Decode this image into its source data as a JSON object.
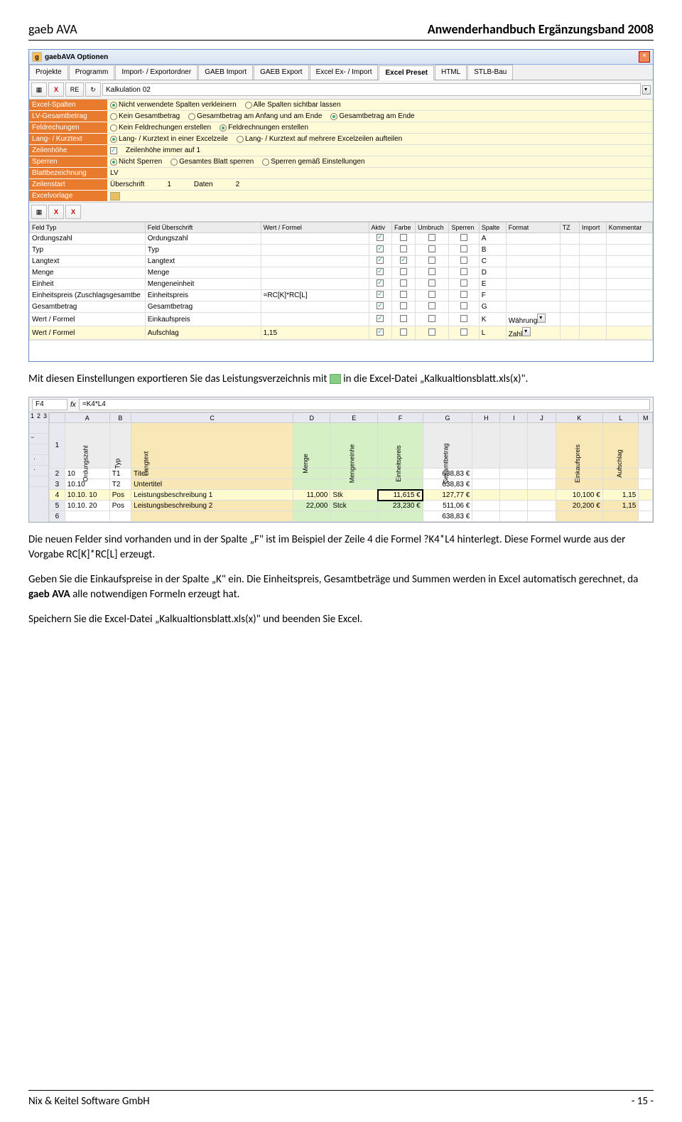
{
  "header": {
    "left": "gaeb AVA",
    "right": "Anwenderhandbuch Ergänzungsband 2008"
  },
  "win1": {
    "title": "gaebAVA Optionen",
    "tabs": [
      "Projekte",
      "Programm",
      "Import- / Exportordner",
      "GAEB Import",
      "GAEB Export",
      "Excel Ex- / Import",
      "Excel Preset",
      "HTML",
      "STLB-Bau"
    ],
    "active_tab": "Excel Preset",
    "tool_labels": {
      "re": "RE"
    },
    "kalk_input": "Kalkulation 02",
    "setting_labels": [
      "Excel-Spalten",
      "LV-Gesamtbetrag",
      "Feldrechungen",
      "Lang- / Kurztext",
      "Zeilenhöhe",
      "Sperren",
      "Blattbezeichnung",
      "Zeilenstart",
      "Excelvorlage"
    ],
    "settings": {
      "spalten": [
        "Nicht verwendete Spalten verkleinern",
        "Alle Spalten sichtbar lassen"
      ],
      "spalten_sel": 0,
      "gesamtbetrag": [
        "Kein Gesamtbetrag",
        "Gesamtbetrag am Anfang und am Ende",
        "Gesamtbetrag am Ende"
      ],
      "gesamtbetrag_sel": 2,
      "feldrech": [
        "Kein Feldrechungen erstellen",
        "Feldrechnungen erstellen"
      ],
      "feldrech_sel": 1,
      "langkurz": [
        "Lang- / Kurztext in einer Excelzeile",
        "Lang- / Kurztext auf mehrere Excelzeilen aufteilen"
      ],
      "langkurz_sel": 0,
      "zeilenhoehe": "Zeilenhöhe immer auf 1",
      "sperren": [
        "Nicht Sperren",
        "Gesamtes Blatt sperren",
        "Sperren gemäß Einstellungen"
      ],
      "sperren_sel": 0,
      "blatt": "LV",
      "zeilenstart_ub": "Überschrift",
      "zeilenstart_ub_v": "1",
      "zeilenstart_d": "Daten",
      "zeilenstart_d_v": "2"
    },
    "field_headers": [
      "Feld Typ",
      "Feld Überschrift",
      "Wert / Formel",
      "Aktiv",
      "Farbe",
      "Umbruch",
      "Sperren",
      "Spalte",
      "Format",
      "TZ",
      "Import",
      "Kommentar"
    ],
    "field_rows": [
      {
        "typ": "Ordungszahl",
        "ub": "Ordungszahl",
        "wf": "",
        "aktiv": true,
        "farbe": false,
        "umb": false,
        "spr": false,
        "sp": "A",
        "fmt": "",
        "tz": "",
        "imp": "",
        "kom": ""
      },
      {
        "typ": "Typ",
        "ub": "Typ",
        "wf": "",
        "aktiv": true,
        "farbe": false,
        "umb": false,
        "spr": false,
        "sp": "B",
        "fmt": "",
        "tz": "",
        "imp": "",
        "kom": ""
      },
      {
        "typ": "Langtext",
        "ub": "Langtext",
        "wf": "",
        "aktiv": true,
        "farbe": true,
        "umb": false,
        "spr": false,
        "sp": "C",
        "fmt": "",
        "tz": "",
        "imp": "",
        "kom": ""
      },
      {
        "typ": "Menge",
        "ub": "Menge",
        "wf": "",
        "aktiv": true,
        "farbe": false,
        "umb": false,
        "spr": false,
        "sp": "D",
        "fmt": "",
        "tz": "",
        "imp": "",
        "kom": ""
      },
      {
        "typ": "Einheit",
        "ub": "Mengeneinheit",
        "wf": "",
        "aktiv": true,
        "farbe": false,
        "umb": false,
        "spr": false,
        "sp": "E",
        "fmt": "",
        "tz": "",
        "imp": "",
        "kom": ""
      },
      {
        "typ": "Einheitspreis (Zuschlagsgesamtbe",
        "ub": "Einheitspreis",
        "wf": "=RC[K]*RC[L]",
        "aktiv": true,
        "farbe": false,
        "umb": false,
        "spr": false,
        "sp": "F",
        "fmt": "",
        "tz": "",
        "imp": "",
        "kom": ""
      },
      {
        "typ": "Gesamtbetrag",
        "ub": "Gesamtbetrag",
        "wf": "",
        "aktiv": true,
        "farbe": false,
        "umb": false,
        "spr": false,
        "sp": "G",
        "fmt": "",
        "tz": "",
        "imp": "",
        "kom": ""
      },
      {
        "typ": "Wert / Formel",
        "ub": "Einkaufspreis",
        "wf": "",
        "aktiv": true,
        "farbe": false,
        "umb": false,
        "spr": false,
        "sp": "K",
        "fmt": "Währung",
        "tz": "",
        "imp": "",
        "kom": "",
        "dd": true
      },
      {
        "typ": "Wert / Formel",
        "ub": "Aufschlag",
        "wf": "1,15",
        "aktiv": true,
        "farbe": false,
        "umb": false,
        "spr": false,
        "sp": "L",
        "fmt": "Zahl",
        "tz": "",
        "imp": "",
        "kom": "",
        "hl": true,
        "dd": true
      }
    ]
  },
  "para1_a": "Mit diesen Einstellungen exportieren Sie das Leistungsverzeichnis mit ",
  "para1_b": " in die Excel-Datei „Kalkualtionsblatt.xls(x)\".",
  "excel": {
    "name_box": "F4",
    "formula": "=K4*L4",
    "outline_hdr": [
      "1",
      "2",
      "3"
    ],
    "col_letters": [
      "A",
      "B",
      "C",
      "D",
      "E",
      "F",
      "G",
      "H",
      "I",
      "J",
      "K",
      "L",
      "M"
    ],
    "vheaders": [
      "Ordungszahl",
      "Typ",
      "Langtext",
      "Menge",
      "Mengeneinhe",
      "Einheitspreis",
      "Gesamtbetrag",
      "",
      "",
      "",
      "Einkaufspreis",
      "Aufschlag",
      ""
    ],
    "rows": [
      {
        "n": "2",
        "oz": "10",
        "typ": "T1",
        "txt": "Titel",
        "d": "",
        "e": "",
        "f": "",
        "g": "638,83 €",
        "k": "",
        "l": ""
      },
      {
        "n": "3",
        "oz": "10.10",
        "typ": "T2",
        "txt": "Untertitel",
        "d": "",
        "e": "",
        "f": "",
        "g": "638,83 €",
        "k": "",
        "l": ""
      },
      {
        "n": "4",
        "oz": "10.10. 10",
        "typ": "Pos",
        "txt": "Leistungsbeschreibung 1",
        "d": "11,000",
        "e": "Stk",
        "f": "11,615 €",
        "g": "127,77 €",
        "k": "10,100 €",
        "l": "1,15",
        "hl": true,
        "sel": true
      },
      {
        "n": "5",
        "oz": "10.10. 20",
        "typ": "Pos",
        "txt": "Leistungsbeschreibung 2",
        "d": "22,000",
        "e": "Stck",
        "f": "23,230 €",
        "g": "511,06 €",
        "k": "20,200 €",
        "l": "1,15"
      },
      {
        "n": "6",
        "oz": "",
        "typ": "",
        "txt": "",
        "d": "",
        "e": "",
        "f": "",
        "g": "638,83 €",
        "k": "",
        "l": ""
      }
    ]
  },
  "para2": "Die neuen Felder sind vorhanden und in der Spalte „F\" ist im Beispiel der Zeile 4 die Formel ?K4*L4 hinterlegt. Diese Formel wurde aus der Vorgabe RC[K]*RC[L] erzeugt.",
  "para3_a": "Geben Sie die Einkaufspreise in der Spalte „K\" ein. Die Einheitspreis, Gesamtbeträge und Summen werden in Excel automatisch gerechnet, da ",
  "para3_b": "gaeb AVA",
  "para3_c": " alle notwendigen Formeln erzeugt hat.",
  "para4": "Speichern Sie die Excel-Datei „Kalkualtionsblatt.xls(x)\" und beenden Sie Excel.",
  "footer": {
    "left": "Nix & Keitel Software GmbH",
    "right": "- 15 -"
  }
}
